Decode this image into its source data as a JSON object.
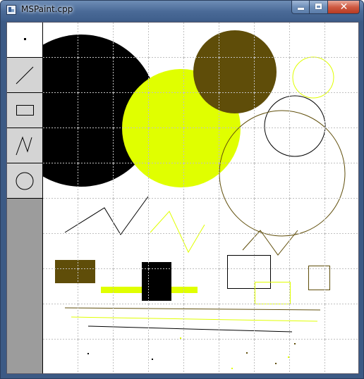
{
  "window": {
    "title": "MSPaint.cpp",
    "title_bar_color": "#3f5f8c",
    "close_button_color": "#c7442c"
  },
  "caption_buttons": {
    "minimize_icon": "minimize-icon",
    "maximize_icon": "maximize-icon",
    "close_glyph": "✕"
  },
  "toolbar": {
    "background": "#9c9c9c",
    "selected_tool": "pixel",
    "tools": [
      {
        "id": "pixel",
        "icon": "pixel-icon"
      },
      {
        "id": "line",
        "icon": "line-icon"
      },
      {
        "id": "rectangle",
        "icon": "rectangle-icon"
      },
      {
        "id": "polyline",
        "icon": "polyline-icon"
      },
      {
        "id": "circle",
        "icon": "circle-icon"
      }
    ]
  },
  "canvas": {
    "background": "#ffffff",
    "grid": true,
    "grid_color": "#c0c0c0",
    "palette": {
      "black": "#000000",
      "yellow": "#e0ff00",
      "brown": "#5f4d09"
    }
  }
}
